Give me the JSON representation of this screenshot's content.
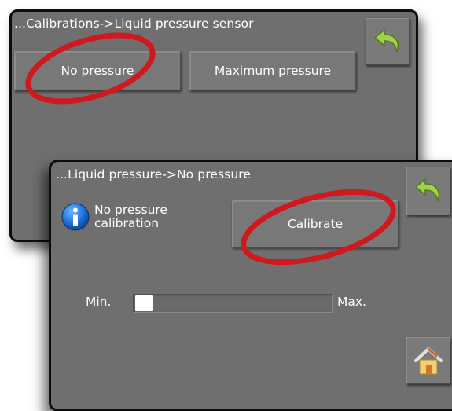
{
  "back_screen": {
    "title": "...Calibrations->Liquid pressure sensor",
    "buttons": {
      "no_pressure": "No pressure",
      "maximum_pressure": "Maximum pressure"
    },
    "back_icon": "back-arrow-icon"
  },
  "front_screen": {
    "title": "...Liquid pressure->No pressure",
    "info": {
      "icon": "info-icon",
      "text_line1": "No pressure",
      "text_line2": "calibration"
    },
    "calibrate_button": "Calibrate",
    "slider": {
      "min_label": "Min.",
      "max_label": "Max.",
      "level_fraction": 0.0
    },
    "back_icon": "back-arrow-icon",
    "home_icon": "home-icon"
  },
  "colors": {
    "panel_bg": "#6f6f6f",
    "panel_border": "#0d0d0d",
    "button_bg": "#787878",
    "text": "#ffffff",
    "highlight_ellipse": "#d0191e",
    "back_arrow": "#9fd24a",
    "info_blue": "#1a6fd6"
  }
}
